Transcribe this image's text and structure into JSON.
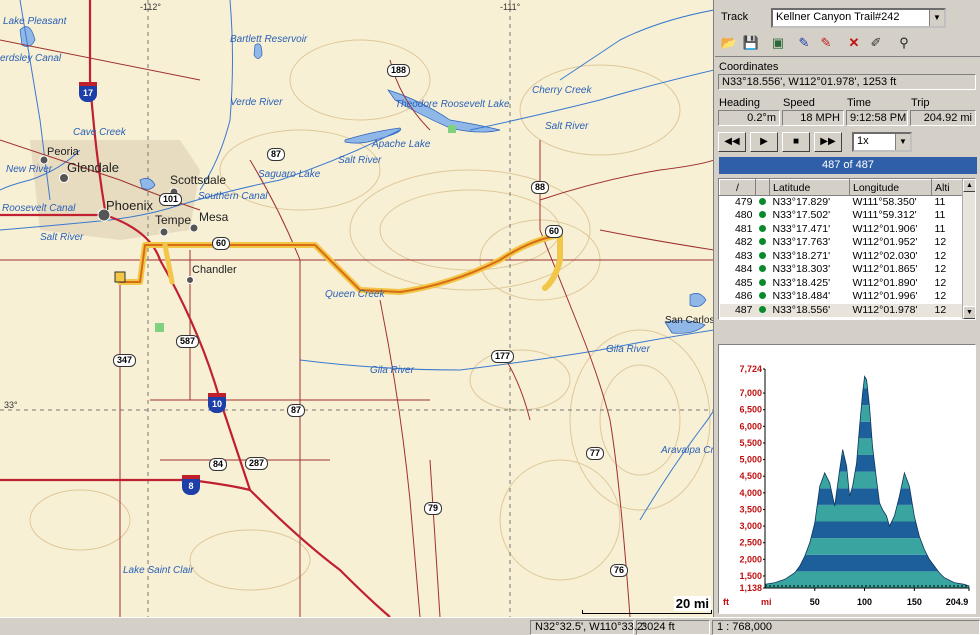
{
  "map": {
    "grid_labels": [
      "-112°",
      "-111°",
      "33°"
    ],
    "scale_label": "20 mi",
    "water_labels": [
      {
        "t": "Lake Pleasant"
      },
      {
        "t": "Bartlett Reservoir"
      },
      {
        "t": "Verde River"
      },
      {
        "t": "Cave Creek"
      },
      {
        "t": "New River"
      },
      {
        "t": "Roosevelt Canal"
      },
      {
        "t": "Salt River"
      },
      {
        "t": "Southern Canal"
      },
      {
        "t": "Saguaro Lake"
      },
      {
        "t": "Salt River"
      },
      {
        "t": "Theodore Roosevelt Lake"
      },
      {
        "t": "Apache Lake"
      },
      {
        "t": "Cherry Creek"
      },
      {
        "t": "Salt River"
      },
      {
        "t": "Queen Creek"
      },
      {
        "t": "Gila River"
      },
      {
        "t": "Gila River"
      },
      {
        "t": "Aravaipa Cr"
      },
      {
        "t": "Lake Saint Clair"
      },
      {
        "t": "San Carlos"
      },
      {
        "t": "erdsley Canal"
      }
    ],
    "city_labels": [
      {
        "t": "Peoria"
      },
      {
        "t": "Glendale"
      },
      {
        "t": "Phoenix"
      },
      {
        "t": "Scottsdale"
      },
      {
        "t": "Tempe"
      },
      {
        "t": "Mesa"
      },
      {
        "t": "Chandler"
      }
    ],
    "highway_labels": [
      "188",
      "87",
      "101",
      "60",
      "88",
      "60",
      "87",
      "587",
      "347",
      "177",
      "84",
      "287",
      "77",
      "79",
      "76"
    ],
    "interstate_labels": [
      "17",
      "10",
      "8"
    ]
  },
  "panel": {
    "track_label": "Track",
    "track_name": "Kellner Canyon Trail#242",
    "coordinates_label": "Coordinates",
    "coordinates_value": "N33°18.556',  W112°01.978',  1253 ft",
    "heading_label": "Heading",
    "speed_label": "Speed",
    "time_label": "Time",
    "trip_label": "Trip",
    "heading_value": "0.2°m",
    "speed_value": "18 MPH",
    "time_value": "9:12:58 PM",
    "trip_value": "204.92 mi",
    "playback_speed": "1x",
    "progress_text": "487 of 487",
    "progress_fraction": 1.0
  },
  "table": {
    "headers": [
      "/",
      "",
      "Latitude",
      "Longitude",
      "Alti"
    ],
    "rows": [
      {
        "n": "479",
        "lat": "N33°17.829'",
        "lon": "W111°58.350'",
        "alt": "11"
      },
      {
        "n": "480",
        "lat": "N33°17.502'",
        "lon": "W111°59.312'",
        "alt": "11"
      },
      {
        "n": "481",
        "lat": "N33°17.471'",
        "lon": "W112°01.906'",
        "alt": "11"
      },
      {
        "n": "482",
        "lat": "N33°17.763'",
        "lon": "W112°01.952'",
        "alt": "12"
      },
      {
        "n": "483",
        "lat": "N33°18.271'",
        "lon": "W112°02.030'",
        "alt": "12"
      },
      {
        "n": "484",
        "lat": "N33°18.303'",
        "lon": "W112°01.865'",
        "alt": "12"
      },
      {
        "n": "485",
        "lat": "N33°18.425'",
        "lon": "W112°01.890'",
        "alt": "12"
      },
      {
        "n": "486",
        "lat": "N33°18.484'",
        "lon": "W112°01.996'",
        "alt": "12"
      },
      {
        "n": "487",
        "lat": "N33°18.556'",
        "lon": "W112°01.978'",
        "alt": "12"
      }
    ]
  },
  "chart_data": {
    "type": "area",
    "y_ticks": [
      "7,724",
      "7,000",
      "6,500",
      "6,000",
      "5,500",
      "5,000",
      "4,500",
      "4,000",
      "3,500",
      "3,000",
      "2,500",
      "2,000",
      "1,500",
      "1,138"
    ],
    "y_unit": "ft",
    "x_unit": "mi",
    "x_ticks": [
      "50",
      "100",
      "150",
      "204.9"
    ],
    "ylim": [
      1138,
      7724
    ],
    "xlim": [
      0,
      204.9
    ],
    "x": [
      0,
      10,
      20,
      30,
      35,
      40,
      45,
      50,
      55,
      60,
      65,
      70,
      75,
      78,
      82,
      85,
      88,
      92,
      95,
      98,
      100,
      102,
      105,
      108,
      112,
      115,
      118,
      122,
      125,
      130,
      135,
      140,
      145,
      150,
      155,
      160,
      165,
      170,
      175,
      180,
      190,
      200,
      204.9
    ],
    "y": [
      1250,
      1300,
      1400,
      1600,
      1800,
      2100,
      2500,
      3100,
      4200,
      4600,
      4300,
      3600,
      4700,
      5300,
      4800,
      3900,
      4200,
      4900,
      6000,
      7000,
      7500,
      7400,
      6600,
      5400,
      4400,
      3700,
      3500,
      3300,
      3000,
      3300,
      3900,
      4600,
      4200,
      3300,
      2700,
      2300,
      2000,
      1800,
      1600,
      1450,
      1300,
      1250,
      1200
    ],
    "colors": {
      "band_a": "#1d5f9a",
      "band_b": "#3aa5a0"
    }
  },
  "status": {
    "cursor_coords": "N32°32.5', W110°33.2'",
    "elevation": "3024 ft",
    "scale": "1 : 768,000"
  }
}
